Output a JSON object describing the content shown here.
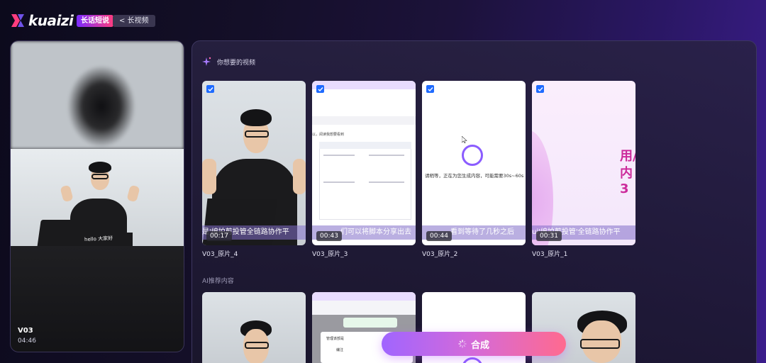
{
  "header": {
    "logo_text": "kuaizi",
    "badge_label": "长话短说",
    "back_label": "< 长视频"
  },
  "preview": {
    "video_name": "V03",
    "duration": "04:46",
    "overlay_text": "hello 大家好"
  },
  "main": {
    "wanted_title": "你想要的视频",
    "recommend_title": "AI推荐内容",
    "wanted_clips": [
      {
        "label": "V03_原片_4",
        "time": "00:17",
        "subtitle": "是'编拍剪投管全链路协作平",
        "checked": true
      },
      {
        "label": "V03_原片_3",
        "time": "00:43",
        "subtitle": "们可以将脚本分享出去",
        "checked": true
      },
      {
        "label": "V03_原片_2",
        "time": "00:44",
        "subtitle": "看到等待了几秒之后",
        "checked": true
      },
      {
        "label": "V03_原片_1",
        "time": "00:31",
        "subtitle": "ui'编拍剪投管'全链路协作平",
        "checked": true
      }
    ],
    "clip3_loading_text": "请稍等，正在为您生成内容，可能需要30s~60s",
    "clip2_doc_heading": "以，阅读我想要看到",
    "clip4_big_text_1": "用/",
    "clip4_big_text_2": "内3",
    "rec_doc_heading": "管理该部是",
    "rec_doc_item": "编注"
  },
  "merge_button": {
    "label": "合成"
  },
  "colors": {
    "accent": "#1f6bff",
    "merge_gradient_start": "#a065ff",
    "merge_gradient_end": "#ff6a8f"
  }
}
